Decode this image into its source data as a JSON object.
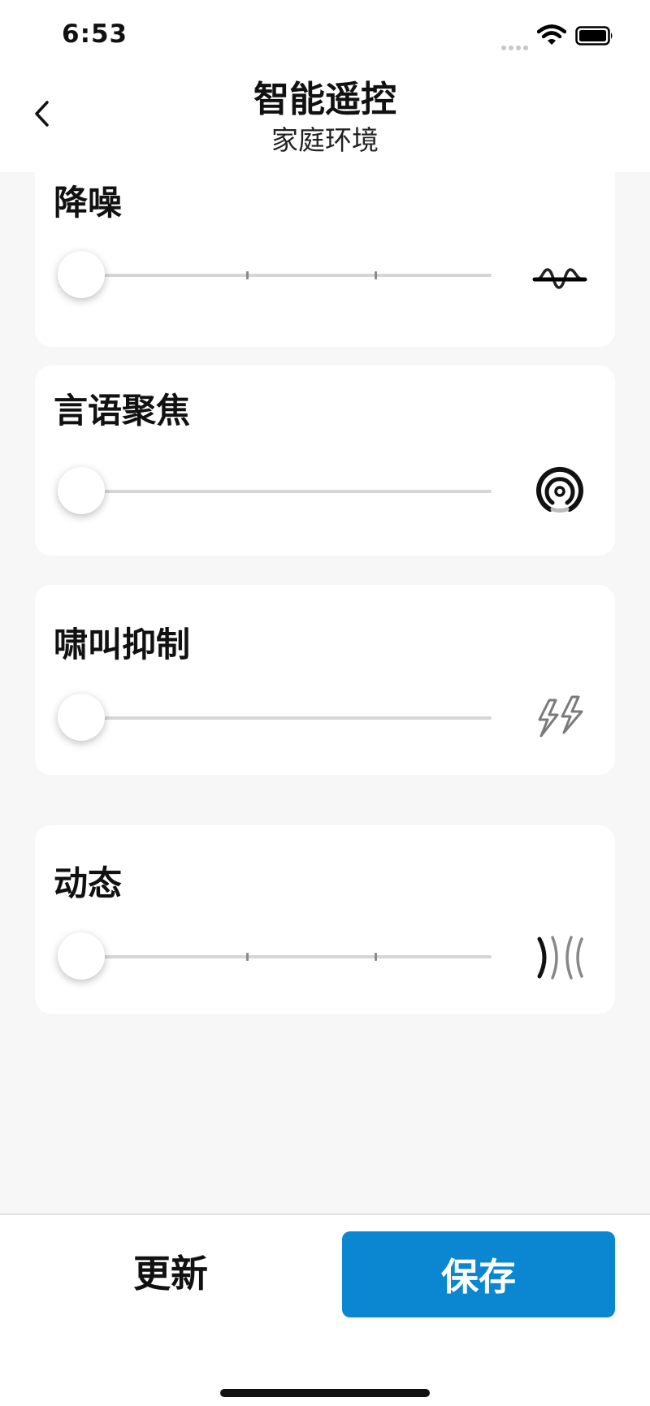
{
  "status_bar": {
    "time": "6:53"
  },
  "nav": {
    "title": "智能遥控",
    "subtitle": "家庭环境"
  },
  "controls": [
    {
      "label": "降噪",
      "value": 0,
      "steps": 4,
      "icon": "noise-reduction-icon"
    },
    {
      "label": "言语聚焦",
      "value": 0,
      "steps": 1,
      "icon": "speech-focus-icon"
    },
    {
      "label": "啸叫抑制",
      "value": 0,
      "steps": 1,
      "icon": "feedback-suppression-icon"
    },
    {
      "label": "动态",
      "value": 0,
      "steps": 4,
      "icon": "dynamic-icon"
    }
  ],
  "bottom_bar": {
    "update_label": "更新",
    "save_label": "保存"
  },
  "colors": {
    "accent": "#0a87d0",
    "background": "#f7f7f7",
    "card": "#ffffff"
  }
}
